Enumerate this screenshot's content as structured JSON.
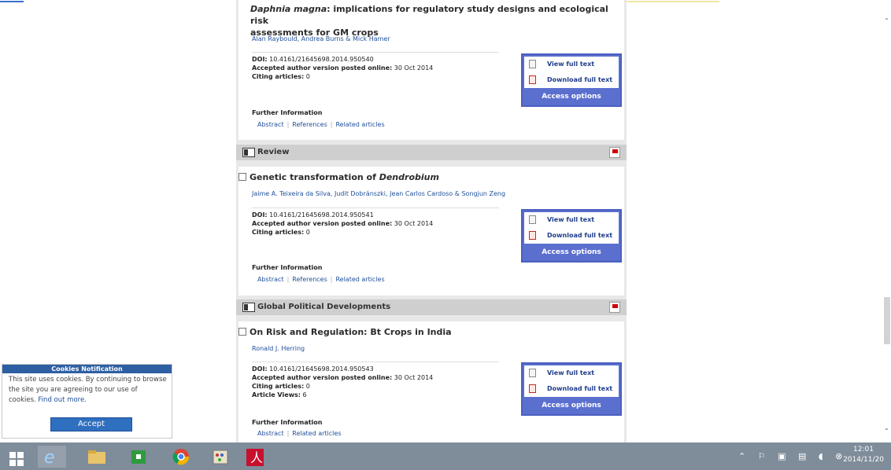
{
  "articles": [
    {
      "title_italic": "Daphnia magna",
      "title_line1_rest": ": implications for regulatory study designs and ecological risk",
      "title_line2": "assessments for GM crops",
      "authors": "Alan Raybould, Andrea Burns & Mick Hamer",
      "doi_label": "DOI:",
      "doi": "10.4161/21645698.2014.950540",
      "accepted_label": "Accepted author version posted online:",
      "accepted": "30 Oct 2014",
      "citing_label": "Citing articles:",
      "citing": "0",
      "further": "Further Information",
      "links": [
        "Abstract",
        "References",
        "Related articles"
      ]
    },
    {
      "title_plain": "Genetic transformation of ",
      "title_italic": "Dendrobium",
      "authors": "Jaime A. Teixeira da Silva, Judit Dobránszki, Jean Carlos Cardoso & Songjun Zeng",
      "doi_label": "DOI:",
      "doi": "10.4161/21645698.2014.950541",
      "accepted_label": "Accepted author version posted online:",
      "accepted": "30 Oct 2014",
      "citing_label": "Citing articles:",
      "citing": "0",
      "further": "Further Information",
      "links": [
        "Abstract",
        "References",
        "Related articles"
      ]
    },
    {
      "title_plain": "On Risk and Regulation: Bt Crops in India",
      "authors": "Ronald J. Herring",
      "doi_label": "DOI:",
      "doi": "10.4161/21645698.2014.950543",
      "accepted_label": "Accepted author version posted online:",
      "accepted": "30 Oct 2014",
      "citing_label": "Citing articles:",
      "citing": "0",
      "views_label": "Article Views:",
      "views": "6",
      "further": "Further Information",
      "links": [
        "Abstract",
        "Related articles"
      ]
    }
  ],
  "access_box": {
    "view_full_text": "View full text",
    "download_full_text": "Download full text",
    "access_options": "Access options"
  },
  "sections": {
    "review": "Review",
    "global": "Global Political Developments"
  },
  "cookie": {
    "title": "Cookies Notification",
    "text": "This site uses cookies. By continuing to browse the site you are agreeing to our use of cookies.",
    "link": "Find out more.",
    "button": "Accept"
  },
  "taskbar": {
    "time": "12:01",
    "date": "2014/11/20",
    "apps": [
      "start",
      "internet-explorer",
      "file-explorer",
      "store",
      "chrome",
      "paint",
      "acrobat-reader"
    ]
  },
  "colors": {
    "accent_blue": "#5b6fcf",
    "link_blue": "#1f4f9a",
    "cookie_header": "#2f5fa3",
    "taskbar": "#7f8c9a"
  }
}
